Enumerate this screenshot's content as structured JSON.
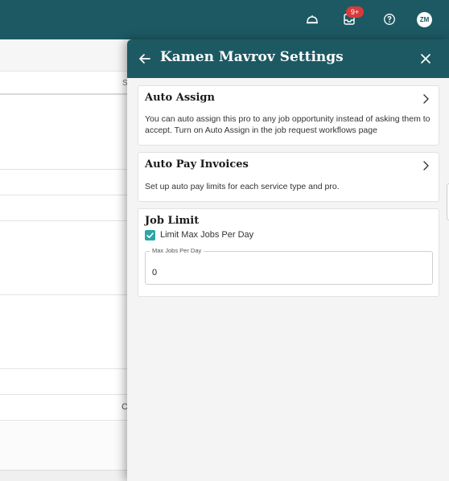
{
  "topbar": {
    "icons": [
      "service-bell-icon",
      "inbox-icon",
      "help-icon"
    ],
    "notification_badge": "9+",
    "avatar_initials": "ZM",
    "color": "#1d5963"
  },
  "background_page": {
    "column_header": "S",
    "row_cell": "C"
  },
  "panel": {
    "title": "Kamen Mavrov Settings",
    "header_color": "#1d5963",
    "auto_assign": {
      "title": "Auto Assign",
      "description": "You can auto assign this pro to any job opportunity instead of asking them to accept. Turn on Auto Assign in the job request workflows page"
    },
    "auto_pay": {
      "title": "Auto Pay Invoices",
      "description": "Set up auto pay limits for each service type and pro."
    },
    "job_limit": {
      "title": "Job Limit",
      "checkbox_label": "Limit Max Jobs Per Day",
      "checkbox_checked": true,
      "field_label": "Max Jobs Per Day",
      "field_value": "0",
      "accent_color": "#2aa6a6"
    }
  }
}
